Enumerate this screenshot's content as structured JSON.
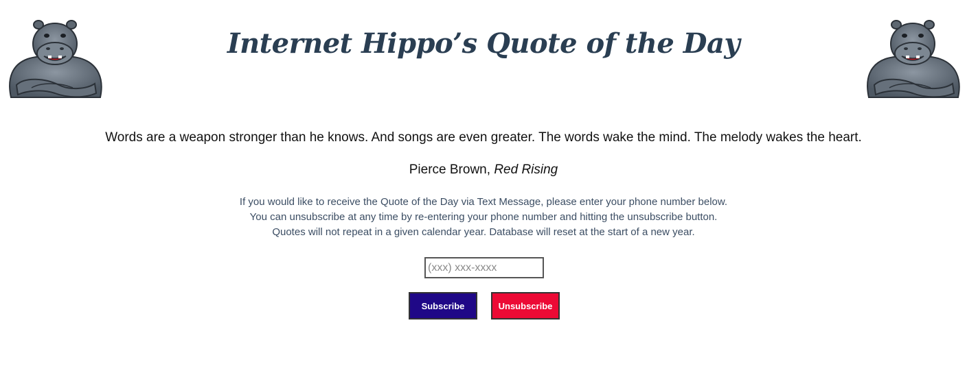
{
  "header": {
    "title": "Internet Hippo’s Quote of the Day"
  },
  "quote": {
    "text": "Words are a weapon stronger than he knows. And songs are even greater. The words wake the mind. The melody wakes the heart.",
    "author": "Pierce Brown,",
    "work": "Red Rising"
  },
  "info": {
    "line1": "If you would like to receive the Quote of the Day via Text Message, please enter your phone number below.",
    "line2": "You can unsubscribe at any time by re-entering your phone number and hitting the unsubscribe button.",
    "line3": "Quotes will not repeat in a given calendar year. Database will reset at the start of a new year."
  },
  "form": {
    "phone_placeholder": "(xxx) xxx-xxxx",
    "phone_value": "",
    "subscribe_label": "Subscribe",
    "unsubscribe_label": "Unsubscribe"
  },
  "colors": {
    "title": "#2a3e52",
    "subscribe_bg": "#1f0887",
    "unsubscribe_bg": "#ec0a35",
    "hippo_body": "#6b7682"
  },
  "icons": {
    "mascot": "hippo-mascot-icon"
  }
}
